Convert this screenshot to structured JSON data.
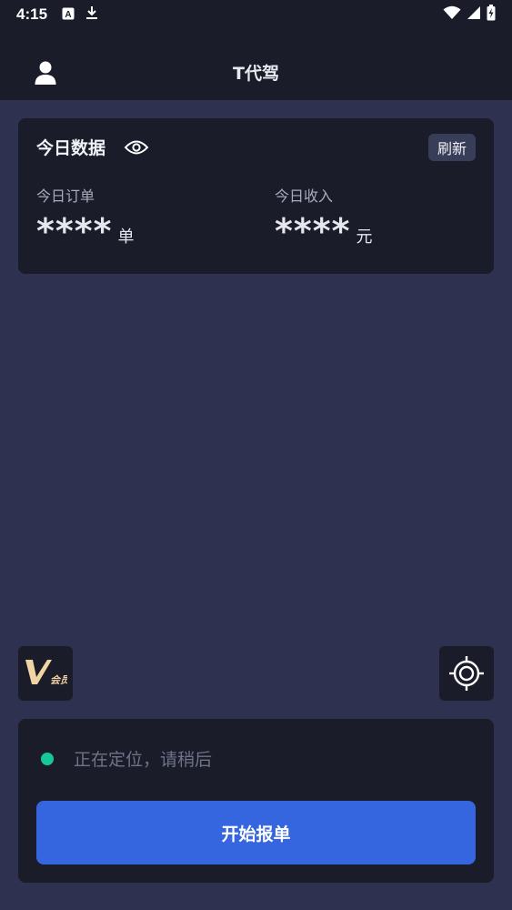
{
  "status_bar": {
    "time": "4:15",
    "left_icons": [
      "font-icon",
      "download-icon"
    ],
    "right_icons": [
      "wifi-icon",
      "signal-icon",
      "battery-charging-icon"
    ]
  },
  "header": {
    "title": "T代驾",
    "user_icon": "user-icon"
  },
  "today_card": {
    "title": "今日数据",
    "refresh_label": "刷新",
    "orders_label": "今日订单",
    "orders_value": "****",
    "orders_unit": "单",
    "income_label": "今日收入",
    "income_value": "****",
    "income_unit": "元"
  },
  "vip": {
    "letter": "V",
    "text": "会员"
  },
  "location": {
    "status_text": "正在定位，请稍后",
    "dot_color": "#16c79a"
  },
  "start_button": {
    "label": "开始报单",
    "color": "#3665e0"
  },
  "colors": {
    "background": "#2e3250",
    "panel": "#1a1c29",
    "accent": "#3665e0"
  }
}
